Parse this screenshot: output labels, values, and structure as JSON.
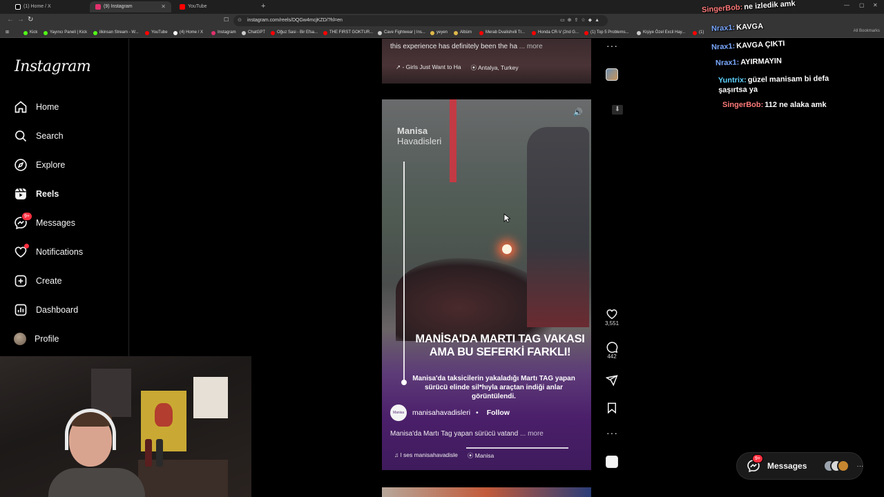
{
  "browser": {
    "tabs": [
      {
        "label": "(1) Home / X",
        "color": "#ffffff"
      },
      {
        "label": "(9) Instagram",
        "color": "#e1306c"
      },
      {
        "label": "YouTube",
        "color": "#ff0000"
      }
    ],
    "new_tab": "+",
    "url": "instagram.com/reels/DQGw4mcjKZD/?hl=en",
    "bookmarks": [
      {
        "label": "Kick",
        "color": "#53fc18"
      },
      {
        "label": "Yayıncı Paneli | Kick",
        "color": "#53fc18"
      },
      {
        "label": "ilkinsan Stream - W...",
        "color": "#53fc18"
      },
      {
        "label": "YouTube",
        "color": "#ff0000"
      },
      {
        "label": "(4) Home / X",
        "color": "#ffffff"
      },
      {
        "label": "Instagram",
        "color": "#e1306c"
      },
      {
        "label": "ChatGPT",
        "color": "#cccccc"
      },
      {
        "label": "Oğuz Sasi - Bir Efsa...",
        "color": "#ff0000"
      },
      {
        "label": "THE FIRST GOKTUR...",
        "color": "#ff0000"
      },
      {
        "label": "Cave Fightwear | Ins...",
        "color": "#cccccc"
      },
      {
        "label": "yeyen",
        "color": "#e0b84a"
      },
      {
        "label": "Albüm",
        "color": "#e0b84a"
      },
      {
        "label": "Merab Dvalishvili Tr...",
        "color": "#ff0000"
      },
      {
        "label": "Honda CR-V (2nd G...",
        "color": "#ff0000"
      },
      {
        "label": "(1) Top 5 Problems...",
        "color": "#ff0000"
      },
      {
        "label": "Kişiye Özel Excil Hay...",
        "color": "#cccccc"
      },
      {
        "label": "(1)",
        "color": "#ff0000"
      }
    ],
    "all_bookmarks": "All Bookmarks"
  },
  "instagram": {
    "logo": "Instagram",
    "nav": [
      {
        "label": "Home",
        "icon": "home-icon"
      },
      {
        "label": "Search",
        "icon": "search-icon"
      },
      {
        "label": "Explore",
        "icon": "compass-icon"
      },
      {
        "label": "Reels",
        "icon": "reels-icon"
      },
      {
        "label": "Messages",
        "icon": "messenger-icon",
        "badge": "9+"
      },
      {
        "label": "Notifications",
        "icon": "heart-icon"
      },
      {
        "label": "Create",
        "icon": "plus-square-icon"
      },
      {
        "label": "Dashboard",
        "icon": "dashboard-icon"
      },
      {
        "label": "Profile",
        "icon": "avatar"
      }
    ],
    "prev_reel": {
      "caption": "this experience has definitely been the ha",
      "more": "... more",
      "audio": "- Girls Just Want to Ha",
      "location": "Antalya, Turkey"
    },
    "reel": {
      "logo_line1": "Manisa",
      "logo_line2": "Havadisleri",
      "headline": "MANİSA'DA MARTI TAG VAKASI AMA BU SEFERKİ FARKLI!",
      "subtitle": "Manisa'da taksicilerin yakaladığı Martı TAG yapan sürücü elinde sil*hıyla araçtan indiği anlar görüntülendi.",
      "username": "manisahavadisleri",
      "separator": "•",
      "follow": "Follow",
      "caption": "Manisa'da Martı Tag yapan sürücü vatand",
      "more": "... more",
      "audio": "l ses   manisahavadisle",
      "location": "Manisa",
      "likes": "3,551",
      "comments": "442",
      "pfp_text": "Manisa"
    },
    "messages_pill": {
      "label": "Messages",
      "badge": "9+",
      "more": "···"
    }
  },
  "chat": [
    {
      "user": "SingerBob:",
      "msg": "ne izledik amk",
      "user_color": "#ff7a7a"
    },
    {
      "user": "Nrax1:",
      "msg": "KAVGA",
      "user_color": "#7aa8ff"
    },
    {
      "user": "Nrax1:",
      "msg": "KAVGA ÇIKTI",
      "user_color": "#7aa8ff"
    },
    {
      "user": "Nrax1:",
      "msg": "AYIRMAYIN",
      "user_color": "#7aa8ff"
    },
    {
      "user": "Yuntrix:",
      "msg": "güzel manisam bi defa şaşırtsa ya",
      "user_color": "#5fd3ff"
    },
    {
      "user": "SingerBob:",
      "msg": "112 ne alaka amk",
      "user_color": "#ff7a7a"
    }
  ]
}
